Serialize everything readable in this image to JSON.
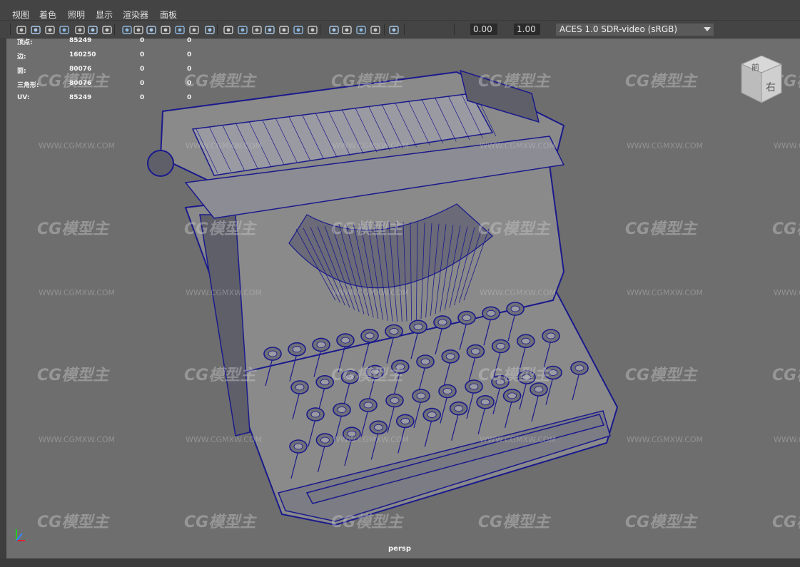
{
  "menu": [
    "视图",
    "着色",
    "照明",
    "显示",
    "渲染器",
    "面板"
  ],
  "toolbar": {
    "exposure_value": "0.00",
    "gamma_value": "1.00",
    "color_space": "ACES 1.0 SDR-video (sRGB)",
    "icons": [
      "camera-select-icon",
      "camera-attributes-icon",
      "bookmark-icon",
      "image-plane-icon",
      "grid-icon",
      "film-gate-icon",
      "resolution-gate-icon",
      "gate-mask-icon",
      "field-chart-icon",
      "safe-action-icon",
      "safe-title-icon",
      "wireframe-icon",
      "smooth-shade-icon",
      "default-material-icon",
      "wireframe-on-shaded-icon",
      "xray-icon",
      "lights-icon",
      "shadows-icon",
      "screen-ao-icon",
      "motion-blur-icon",
      "antialias-icon",
      "depth-of-field-icon",
      "isolate-select-icon",
      "exposure-icon",
      "gamma-icon",
      "color-management-icon"
    ]
  },
  "hud_stats": {
    "rows": [
      {
        "label": "顶点:",
        "v1": "85249",
        "v2": "0",
        "v3": "0"
      },
      {
        "label": "边:",
        "v1": "160250",
        "v2": "0",
        "v3": "0"
      },
      {
        "label": "面:",
        "v1": "80076",
        "v2": "0",
        "v3": "0"
      },
      {
        "label": "三角形:",
        "v1": "80076",
        "v2": "0",
        "v3": "0"
      },
      {
        "label": "UV:",
        "v1": "85249",
        "v2": "0",
        "v3": "0"
      }
    ]
  },
  "viewport": {
    "camera_label": "persp",
    "viewcube_labels": [
      "前",
      "右"
    ],
    "wireframe_color": "#1a1a8c",
    "background_color": "#6e6e6e"
  },
  "watermark": {
    "logo_text": "CG模型主",
    "url_text": "WWW.CGMXW.COM"
  }
}
